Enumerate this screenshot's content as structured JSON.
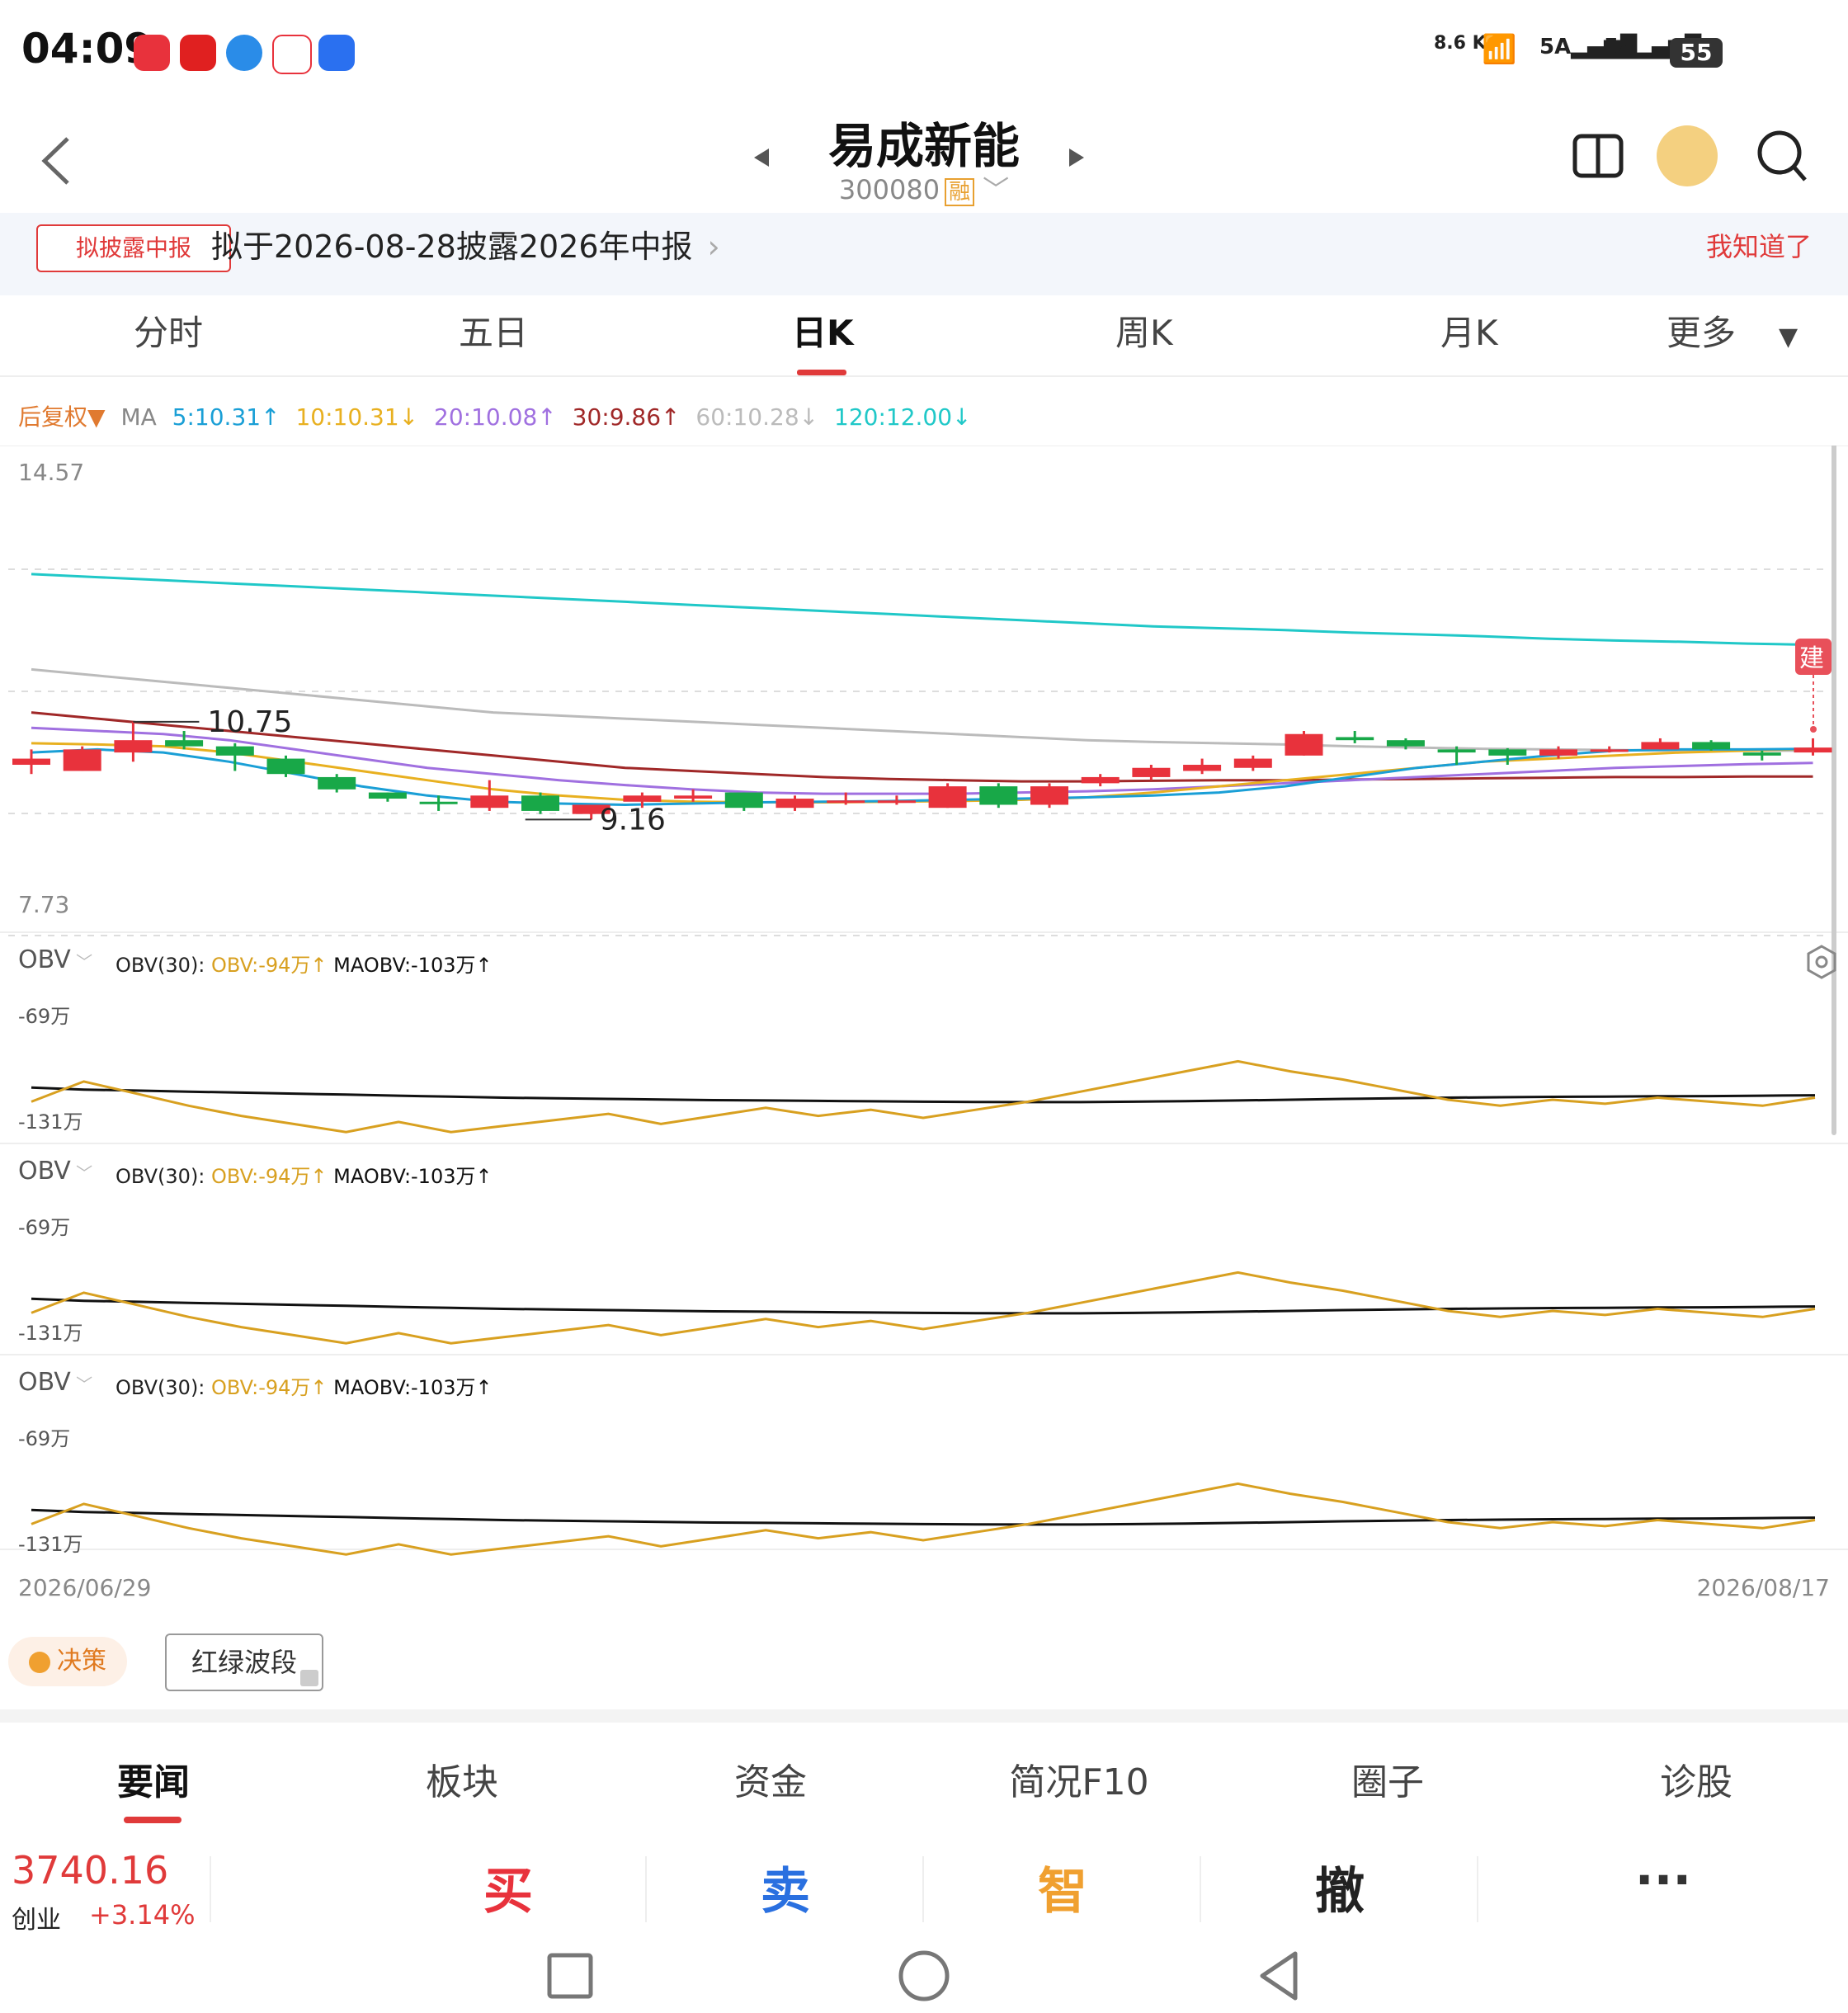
{
  "status": {
    "time": "04:09",
    "net_speed": "8.6 K/s",
    "signal1": "5A",
    "signal2": "5A",
    "battery": "55"
  },
  "header": {
    "stock_name": "易成新能",
    "stock_code": "300080",
    "margin_badge": "融"
  },
  "notice": {
    "badge": "拟披露中报",
    "text": "拟于2026-08-28披露2026年中报",
    "dismiss": "我知道了"
  },
  "period_tabs": [
    "分时",
    "五日",
    "日K",
    "周K",
    "月K",
    "更多"
  ],
  "active_period": "日K",
  "ma_legend": {
    "adjust": "后复权▼",
    "ma_label": "MA",
    "ma5": "5:10.31↑",
    "ma10": "10:10.31↓",
    "ma20": "20:10.08↑",
    "ma30": "30:9.86↑",
    "ma60": "60:10.28↓",
    "ma120": "120:12.00↓"
  },
  "colors": {
    "ma5": "#1a9fd6",
    "ma10": "#e8b020",
    "ma20": "#a070e0",
    "ma30": "#a02828",
    "ma60": "#bbbbbb",
    "ma120": "#20c8c8",
    "up": "#e8323c",
    "down": "#18a848",
    "obv": "#d8a020",
    "maobv": "#111111"
  },
  "chart_data": [
    {
      "type": "candlestick",
      "y_max_label": "14.57",
      "y_min_label": "7.73",
      "ylim": [
        7.73,
        14.57
      ],
      "high_label": "10.75",
      "low_label": "9.16",
      "build_marker": "建",
      "x_start": "2026/06/29",
      "x_end": "2026/08/17",
      "candles": [
        {
          "o": 10.05,
          "c": 10.15,
          "h": 10.3,
          "l": 9.9
        },
        {
          "o": 9.95,
          "c": 10.3,
          "h": 10.35,
          "l": 9.95
        },
        {
          "o": 10.25,
          "c": 10.45,
          "h": 10.75,
          "l": 10.1
        },
        {
          "o": 10.45,
          "c": 10.35,
          "h": 10.6,
          "l": 10.3
        },
        {
          "o": 10.35,
          "c": 10.2,
          "h": 10.4,
          "l": 9.95
        },
        {
          "o": 10.15,
          "c": 9.9,
          "h": 10.2,
          "l": 9.85
        },
        {
          "o": 9.85,
          "c": 9.65,
          "h": 9.9,
          "l": 9.6
        },
        {
          "o": 9.6,
          "c": 9.5,
          "h": 9.6,
          "l": 9.45
        },
        {
          "o": 9.45,
          "c": 9.43,
          "h": 9.55,
          "l": 9.3
        },
        {
          "o": 9.35,
          "c": 9.55,
          "h": 9.8,
          "l": 9.3
        },
        {
          "o": 9.55,
          "c": 9.3,
          "h": 9.6,
          "l": 9.25
        },
        {
          "o": 9.25,
          "c": 9.4,
          "h": 9.4,
          "l": 9.16
        },
        {
          "o": 9.45,
          "c": 9.55,
          "h": 9.6,
          "l": 9.35
        },
        {
          "o": 9.5,
          "c": 9.55,
          "h": 9.65,
          "l": 9.45
        },
        {
          "o": 9.6,
          "c": 9.35,
          "h": 9.6,
          "l": 9.3
        },
        {
          "o": 9.35,
          "c": 9.5,
          "h": 9.55,
          "l": 9.3
        },
        {
          "o": 9.45,
          "c": 9.47,
          "h": 9.6,
          "l": 9.4
        },
        {
          "o": 9.45,
          "c": 9.47,
          "h": 9.55,
          "l": 9.4
        },
        {
          "o": 9.35,
          "c": 9.7,
          "h": 9.75,
          "l": 9.35
        },
        {
          "o": 9.7,
          "c": 9.4,
          "h": 9.75,
          "l": 9.35
        },
        {
          "o": 9.4,
          "c": 9.7,
          "h": 9.75,
          "l": 9.35
        },
        {
          "o": 9.75,
          "c": 9.85,
          "h": 9.9,
          "l": 9.7
        },
        {
          "o": 9.85,
          "c": 10.0,
          "h": 10.05,
          "l": 9.8
        },
        {
          "o": 9.95,
          "c": 10.05,
          "h": 10.15,
          "l": 9.9
        },
        {
          "o": 10.0,
          "c": 10.15,
          "h": 10.2,
          "l": 9.95
        },
        {
          "o": 10.2,
          "c": 10.55,
          "h": 10.6,
          "l": 10.2
        },
        {
          "o": 10.5,
          "c": 10.45,
          "h": 10.6,
          "l": 10.4
        },
        {
          "o": 10.45,
          "c": 10.35,
          "h": 10.48,
          "l": 10.3
        },
        {
          "o": 10.3,
          "c": 10.25,
          "h": 10.35,
          "l": 10.05
        },
        {
          "o": 10.3,
          "c": 10.2,
          "h": 10.32,
          "l": 10.05
        },
        {
          "o": 10.2,
          "c": 10.3,
          "h": 10.35,
          "l": 10.15
        },
        {
          "o": 10.3,
          "c": 10.3,
          "h": 10.35,
          "l": 10.25
        },
        {
          "o": 10.3,
          "c": 10.42,
          "h": 10.48,
          "l": 10.3
        },
        {
          "o": 10.42,
          "c": 10.3,
          "h": 10.45,
          "l": 10.28
        },
        {
          "o": 10.25,
          "c": 10.2,
          "h": 10.28,
          "l": 10.12
        },
        {
          "o": 10.25,
          "c": 10.33,
          "h": 10.48,
          "l": 10.2
        }
      ],
      "ma": {
        "ma5": [
          10.25,
          10.3,
          10.25,
          10.1,
          9.9,
          9.7,
          9.55,
          9.45,
          9.42,
          9.4,
          9.42,
          9.44,
          9.45,
          9.46,
          9.48,
          9.5,
          9.52,
          9.55,
          9.6,
          9.7,
          9.85,
          10.0,
          10.1,
          10.2,
          10.28,
          10.3,
          10.3,
          10.31
        ],
        "ma10": [
          10.4,
          10.38,
          10.35,
          10.25,
          10.1,
          9.95,
          9.8,
          9.65,
          9.55,
          9.48,
          9.45,
          9.44,
          9.44,
          9.45,
          9.46,
          9.48,
          9.52,
          9.6,
          9.7,
          9.8,
          9.9,
          10.0,
          10.1,
          10.15,
          10.2,
          10.25,
          10.28,
          10.31
        ],
        "ma20": [
          10.65,
          10.6,
          10.55,
          10.45,
          10.3,
          10.15,
          10.0,
          9.9,
          9.8,
          9.72,
          9.65,
          9.6,
          9.58,
          9.58,
          9.58,
          9.6,
          9.62,
          9.65,
          9.7,
          9.75,
          9.8,
          9.85,
          9.9,
          9.95,
          10.0,
          10.03,
          10.06,
          10.08
        ],
        "ma30": [
          10.9,
          10.8,
          10.7,
          10.6,
          10.5,
          10.4,
          10.3,
          10.2,
          10.1,
          10.0,
          9.95,
          9.9,
          9.85,
          9.82,
          9.8,
          9.78,
          9.78,
          9.79,
          9.8,
          9.8,
          9.81,
          9.82,
          9.83,
          9.84,
          9.85,
          9.85,
          9.86,
          9.86
        ],
        "ma60": [
          11.6,
          11.5,
          11.4,
          11.3,
          11.2,
          11.1,
          11.0,
          10.9,
          10.85,
          10.8,
          10.75,
          10.7,
          10.65,
          10.6,
          10.55,
          10.5,
          10.45,
          10.42,
          10.4,
          10.38,
          10.35,
          10.33,
          10.31,
          10.3,
          10.29,
          10.28,
          10.28,
          10.28
        ],
        "ma120": [
          13.15,
          13.1,
          13.05,
          13.0,
          12.95,
          12.9,
          12.85,
          12.8,
          12.75,
          12.7,
          12.65,
          12.6,
          12.55,
          12.5,
          12.45,
          12.4,
          12.35,
          12.3,
          12.27,
          12.24,
          12.2,
          12.17,
          12.14,
          12.1,
          12.07,
          12.05,
          12.02,
          12.0
        ]
      }
    },
    {
      "type": "line",
      "panels": 3,
      "indicator": "OBV",
      "params_label": "OBV(30):",
      "obv_label": "OBV:-94万↑",
      "maobv_label": "MAOBV:-103万↑",
      "y_top_label": "-69万",
      "y_bottom_label": "-131万",
      "ylim": [
        -131,
        -69
      ],
      "obv": [
        -112,
        -102,
        -108,
        -114,
        -119,
        -123,
        -127,
        -122,
        -127,
        -124,
        -121,
        -118,
        -123,
        -119,
        -115,
        -119,
        -116,
        -120,
        -116,
        -112,
        -107,
        -102,
        -97,
        -92,
        -97,
        -101,
        -106,
        -111,
        -114,
        -111,
        -113,
        -110,
        -112,
        -114,
        -110
      ],
      "maobv": [
        -105,
        -106,
        -106.5,
        -107,
        -107.5,
        -108,
        -108.5,
        -109,
        -109.5,
        -110,
        -110.3,
        -110.6,
        -110.9,
        -111.2,
        -111.4,
        -111.6,
        -111.8,
        -112,
        -112.1,
        -112.2,
        -112.2,
        -112,
        -111.7,
        -111.4,
        -111,
        -110.6,
        -110.3,
        -110,
        -109.8,
        -109.6,
        -109.5,
        -109.3,
        -109.2,
        -109,
        -108.8
      ]
    }
  ],
  "tools": {
    "decide": "决策",
    "wave": "红绿波段"
  },
  "news_tabs": [
    "要闻",
    "板块",
    "资金",
    "简况F10",
    "圈子",
    "诊股"
  ],
  "trade_bar": {
    "index_value": "3740.16",
    "index_name": "创业",
    "index_change": "+3.14%",
    "buy": "买",
    "sell": "卖",
    "smart": "智",
    "cancel": "撤",
    "more": "···"
  }
}
